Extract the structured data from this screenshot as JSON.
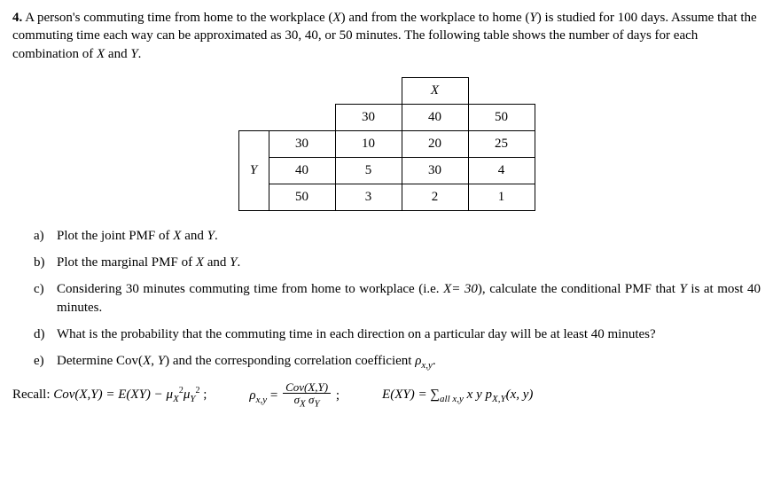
{
  "problem": {
    "number": "4.",
    "statement_part1": "A person's commuting time from home to the workplace (",
    "var_x": "X",
    "statement_part2": ") and from the workplace to home (",
    "var_y": "Y",
    "statement_part3": ") is studied for 100 days. Assume that the commuting time each way can be approximated as 30, 40, or 50 minutes. The following table shows the number of days for each combination of ",
    "statement_part4": " and ",
    "statement_part5": "."
  },
  "table": {
    "x_header": "X",
    "y_header": "Y",
    "x_levels": [
      "30",
      "40",
      "50"
    ],
    "y_levels": [
      "30",
      "40",
      "50"
    ],
    "rows": [
      [
        "10",
        "20",
        "25"
      ],
      [
        "5",
        "30",
        "4"
      ],
      [
        "3",
        "2",
        "1"
      ]
    ]
  },
  "parts": {
    "a": {
      "marker": "a)",
      "text1": "Plot the joint PMF of ",
      "text2": " and ",
      "text3": "."
    },
    "b": {
      "marker": "b)",
      "text1": "Plot the marginal PMF of ",
      "text2": " and ",
      "text3": "."
    },
    "c": {
      "marker": "c)",
      "text1": "Considering 30 minutes commuting time from home to workplace (i.e. ",
      "eq": "X= 30",
      "text2": "), calculate the conditional PMF that ",
      "text3": " is at most 40 minutes."
    },
    "d": {
      "marker": "d)",
      "text": "What is the probability that the commuting time in each direction on a particular day will be at least 40 minutes?"
    },
    "e": {
      "marker": "e)",
      "text1": "Determine Cov(",
      "text2": ", ",
      "text3": ") and the corresponding correlation coefficient ",
      "rho": "ρ",
      "sub": "x,y",
      "text4": "."
    }
  },
  "recall": {
    "label": "Recall:",
    "cov_def_lhs": "Cov(X,Y) = E(XY) − μ",
    "mu_x_sub": "X",
    "sq1": "2",
    "mu": "μ",
    "mu_y_sub": "Y",
    "sq2": "2",
    "semicolon1": " ;",
    "rho_lhs": "ρ",
    "rho_sub": "x,y",
    "eq": " = ",
    "frac_num": "Cov(X,Y)",
    "frac_den": "σ",
    "sigma_x": "X",
    "sigma_y": "Y",
    "space": " ",
    "semicolon2": " ;",
    "exy_lhs": "E(XY) = ∑",
    "sum_sub": "all x,y",
    "exy_rhs": " x y p",
    "p_sub": "X,Y",
    "exy_args": "(x, y)"
  }
}
